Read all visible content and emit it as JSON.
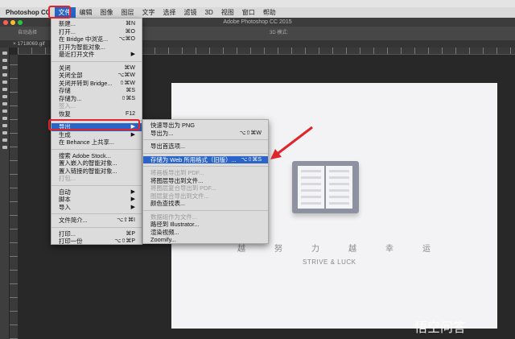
{
  "menubar": {
    "app": "Photoshop CC",
    "items": [
      "文件",
      "编辑",
      "图像",
      "图层",
      "文字",
      "选择",
      "滤镜",
      "3D",
      "视图",
      "窗口",
      "帮助"
    ]
  },
  "window_title": "Adobe Photoshop CC 2015",
  "options": {
    "auto_select": "自动选择",
    "mode_3d": "3D 模式:"
  },
  "doc_tab": "× 1718069.gif",
  "file_menu": [
    {
      "label": "新建...",
      "sc": "⌘N"
    },
    {
      "label": "打开...",
      "sc": "⌘O"
    },
    {
      "label": "在 Bridge 中浏览...",
      "sc": "⌥⌘O"
    },
    {
      "label": "打开为智能对象..."
    },
    {
      "label": "最近打开文件",
      "sc": "▶"
    },
    {
      "sep": true
    },
    {
      "label": "关闭",
      "sc": "⌘W"
    },
    {
      "label": "关闭全部",
      "sc": "⌥⌘W"
    },
    {
      "label": "关闭并转到 Bridge...",
      "sc": "⇧⌘W"
    },
    {
      "label": "存储",
      "sc": "⌘S"
    },
    {
      "label": "存储为...",
      "sc": "⇧⌘S"
    },
    {
      "label": "签入...",
      "dis": true
    },
    {
      "label": "恢复",
      "sc": "F12"
    },
    {
      "sep": true
    },
    {
      "label": "导出",
      "sc": "▶",
      "hl": true
    },
    {
      "label": "生成",
      "sc": "▶"
    },
    {
      "label": "在 Behance 上共享..."
    },
    {
      "sep": true
    },
    {
      "label": "搜索 Adobe Stock..."
    },
    {
      "label": "置入嵌入的智能对象..."
    },
    {
      "label": "置入链接的智能对象..."
    },
    {
      "label": "打包...",
      "dis": true
    },
    {
      "sep": true
    },
    {
      "label": "自动",
      "sc": "▶"
    },
    {
      "label": "脚本",
      "sc": "▶"
    },
    {
      "label": "导入",
      "sc": "▶"
    },
    {
      "sep": true
    },
    {
      "label": "文件简介...",
      "sc": "⌥⇧⌘I"
    },
    {
      "sep": true
    },
    {
      "label": "打印...",
      "sc": "⌘P"
    },
    {
      "label": "打印一份",
      "sc": "⌥⇧⌘P"
    }
  ],
  "export_submenu": [
    {
      "label": "快速导出为 PNG"
    },
    {
      "label": "导出为...",
      "sc": "⌥⇧⌘W"
    },
    {
      "sep": true
    },
    {
      "label": "导出首选项..."
    },
    {
      "sep": true
    },
    {
      "label": "存储为 Web 所用格式（旧版）...",
      "sc": "⌥⇧⌘S",
      "hl": true
    },
    {
      "sep": true
    },
    {
      "label": "将画板导出到 PDF...",
      "dis": true
    },
    {
      "label": "将图层导出到文件..."
    },
    {
      "label": "将图层复合导出到 PDF...",
      "dis": true
    },
    {
      "label": "图层复合导出到文件...",
      "dis": true
    },
    {
      "label": "颜色查找表..."
    },
    {
      "sep": true
    },
    {
      "label": "数据组作为文件...",
      "dis": true
    },
    {
      "label": "路径到 Illustrator..."
    },
    {
      "label": "渲染视频..."
    },
    {
      "label": "Zoomify..."
    }
  ],
  "canvas": {
    "chars": [
      "越",
      "努",
      "力",
      "越",
      "幸",
      "运"
    ],
    "subtitle": "STRIVE & LUCK"
  },
  "watermark": "悟空问答",
  "colors": {
    "highlight": "#2a64c8",
    "annotation": "#e0242b"
  }
}
